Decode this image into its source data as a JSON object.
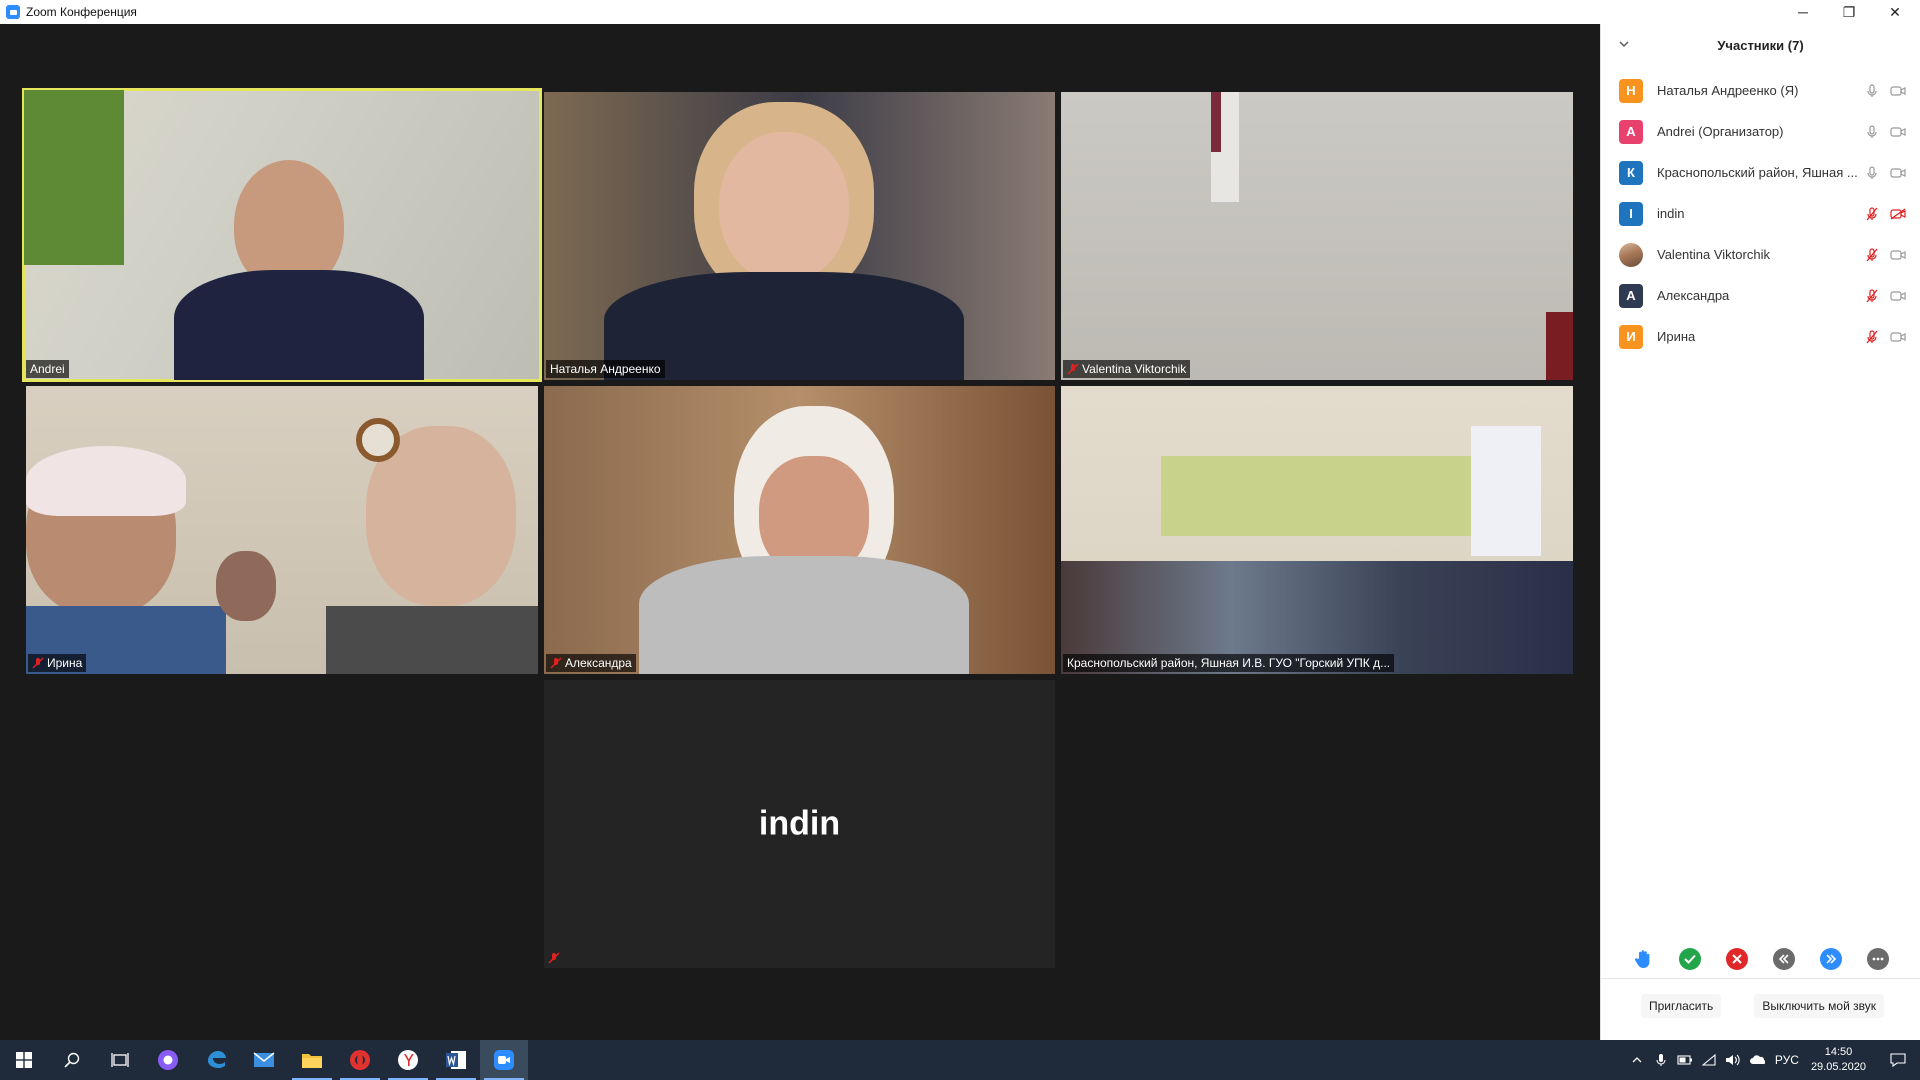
{
  "window": {
    "title": "Zoom Конференция",
    "minimize": "─",
    "restore": "❐",
    "close": "✕"
  },
  "tiles": [
    {
      "name": "Andrei",
      "muted": false,
      "active": true
    },
    {
      "name": "Наталья Андреенко",
      "muted": false,
      "active": false
    },
    {
      "name": "Valentina Viktorchik",
      "muted": true,
      "active": false
    },
    {
      "name": "Ирина",
      "muted": true,
      "active": false
    },
    {
      "name": "Александра",
      "muted": true,
      "active": false
    },
    {
      "name": "Краснопольский район, Яшная И.В. ГУО \"Горский УПК д...",
      "muted": false,
      "active": false
    },
    {
      "name": "indin",
      "muted": true,
      "video_off": true
    }
  ],
  "participants_panel": {
    "title": "Участники (7)",
    "participants": [
      {
        "initial": "Н",
        "name": "Наталья Андреенко (Я)",
        "color": "#f7931e",
        "mic_muted": false,
        "video_off": false
      },
      {
        "initial": "A",
        "name": "Andrei (Организатор)",
        "color": "#e8416d",
        "mic_muted": false,
        "video_off": false
      },
      {
        "initial": "К",
        "name": "Краснопольский район, Яшная ...",
        "color": "#1e74bd",
        "mic_muted": false,
        "video_off": false
      },
      {
        "initial": "I",
        "name": "indin",
        "color": "#1e74bd",
        "mic_muted": true,
        "video_off": true
      },
      {
        "initial": "",
        "name": "Valentina Viktorchik",
        "color": "photo",
        "mic_muted": true,
        "video_off": false
      },
      {
        "initial": "А",
        "name": "Александра",
        "color": "#2f3b52",
        "mic_muted": true,
        "video_off": false
      },
      {
        "initial": "И",
        "name": "Ирина",
        "color": "#f7931e",
        "mic_muted": true,
        "video_off": false
      }
    ],
    "invite_label": "Пригласить",
    "mute_me_label": "Выключить мой звук"
  },
  "taskbar": {
    "language": "РУС",
    "time": "14:50",
    "date": "29.05.2020",
    "apps": [
      "windows-start-icon",
      "search-icon",
      "task-view-icon",
      "alice-icon",
      "edge-icon",
      "mail-icon",
      "file-explorer-icon",
      "opera-icon",
      "yandex-browser-icon",
      "word-icon",
      "zoom-icon"
    ]
  },
  "colors": {
    "active_speaker": "#e6e65c",
    "muted_red": "#e02020",
    "accent_blue": "#2d8cff"
  }
}
